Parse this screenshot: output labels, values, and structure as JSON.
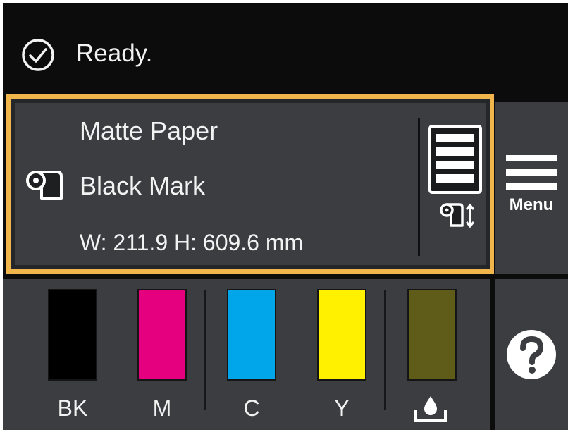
{
  "status": {
    "icon": "checkmark-circle-icon",
    "text": "Ready."
  },
  "paper": {
    "type": "Matte Paper",
    "source": "Black Mark",
    "size": "W: 211.9 H: 609.6 mm",
    "source_icon": "roll-paper-icon",
    "settings_icons": [
      "page-icon",
      "roll-feed-icon"
    ]
  },
  "menu": {
    "label": "Menu",
    "icon": "hamburger-icon"
  },
  "inks": [
    {
      "label": "BK",
      "color": "#000000"
    },
    {
      "label": "M",
      "color": "#e5007f"
    },
    {
      "label": "C",
      "color": "#00a6e9"
    },
    {
      "label": "Y",
      "color": "#fff100"
    },
    {
      "label": "",
      "icon": "maintenance-box-icon",
      "color": "#5f5c1a"
    }
  ],
  "help": {
    "icon": "question-mark-circle-icon"
  },
  "colors": {
    "accent_border": "#f0b64c",
    "panel": "#3b3d40",
    "background": "#0c0c0c"
  }
}
